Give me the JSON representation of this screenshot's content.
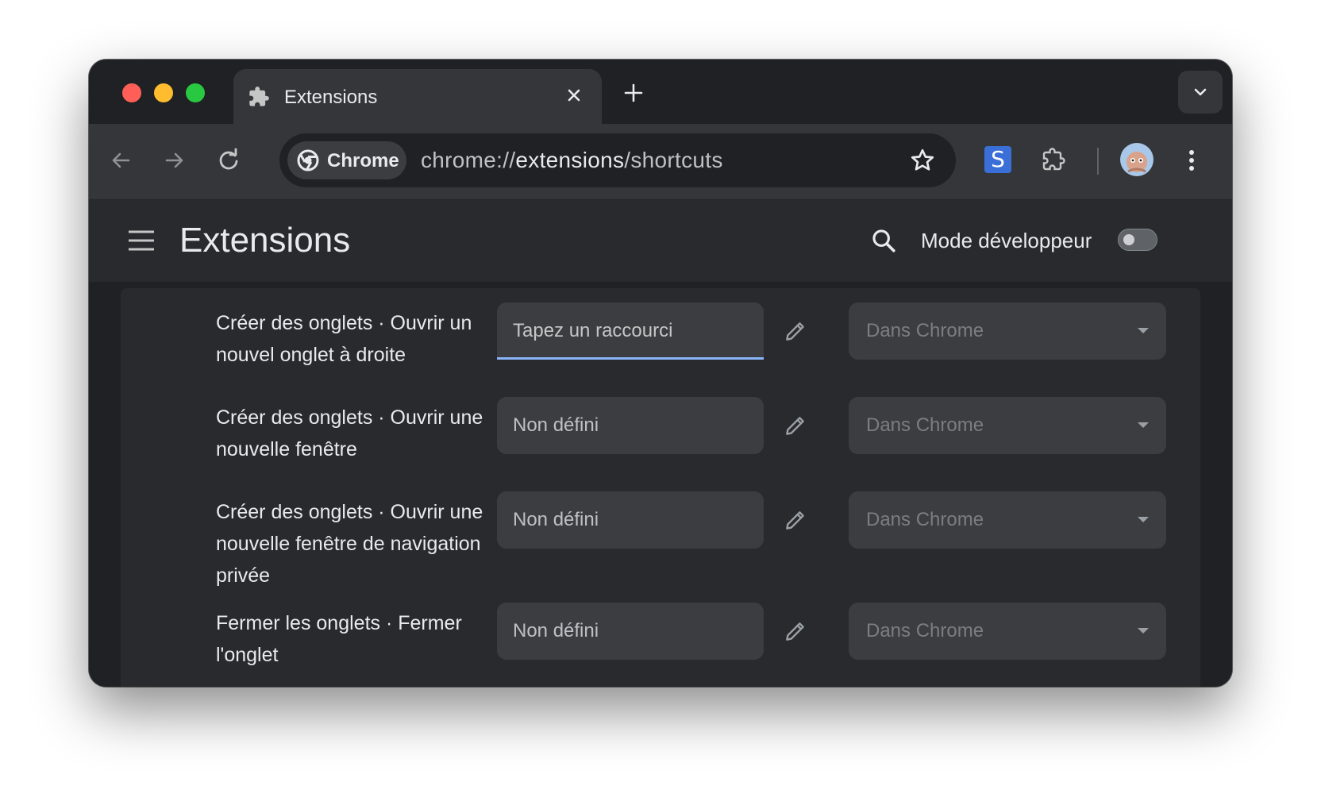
{
  "window": {
    "tab": {
      "title": "Extensions"
    }
  },
  "toolbar": {
    "chip_label": "Chrome",
    "url_scheme": "chrome://",
    "url_host": "extensions",
    "url_path": "/shortcuts",
    "extension_badge": "S"
  },
  "header": {
    "title": "Extensions",
    "dev_mode_label": "Mode développeur",
    "dev_mode_on": false
  },
  "shortcuts": [
    {
      "command": "Créer des onglets · Ouvrir un nouvel onglet à droite",
      "shortcut": "Tapez un raccourci",
      "active": true,
      "scope": "Dans Chrome"
    },
    {
      "command": "Créer des onglets · Ouvrir une nouvelle fenêtre",
      "shortcut": "Non défini",
      "active": false,
      "scope": "Dans Chrome"
    },
    {
      "command": "Créer des onglets · Ouvrir une nouvelle fenêtre de navigation privée",
      "shortcut": "Non défini",
      "active": false,
      "scope": "Dans Chrome"
    },
    {
      "command": "Fermer les onglets · Fermer l'onglet",
      "shortcut": "Non défini",
      "active": false,
      "scope": "Dans Chrome"
    }
  ],
  "colors": {
    "accent": "#8ab4f8",
    "traffic_close": "#ff5f57",
    "traffic_min": "#febc2e",
    "traffic_max": "#28c840"
  }
}
